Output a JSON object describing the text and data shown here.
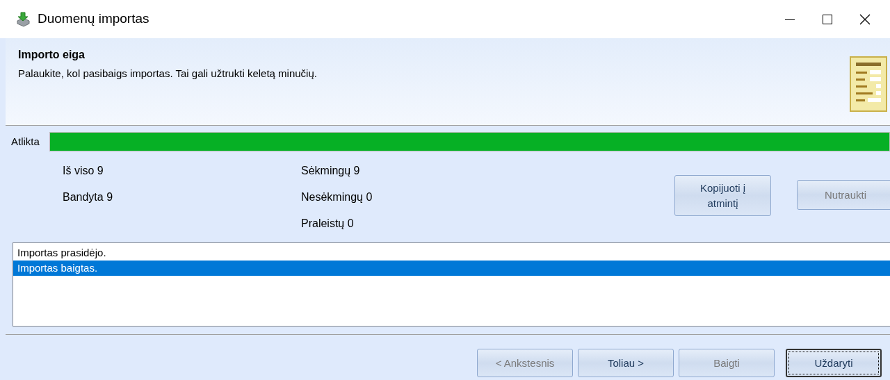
{
  "window": {
    "title": "Duomenų importas"
  },
  "header": {
    "title": "Importo eiga",
    "subtitle": "Palaukite, kol pasibaigs importas. Tai gali užtrukti keletą minučių."
  },
  "progress": {
    "label": "Atlikta",
    "level": 1
  },
  "stats_left": [
    "Iš viso 9",
    "Bandyta 9"
  ],
  "stats_right": [
    "Sėkmingų 9",
    "Nesėkmingų 0",
    "Praleistų 0"
  ],
  "side_buttons": [
    {
      "label": "Kopijuoti į atmintį",
      "disabled": false
    },
    {
      "label": "Nutraukti",
      "disabled": true
    }
  ],
  "log": [
    {
      "text": "Importas prasidėjo.",
      "selected": false
    },
    {
      "text": "Importas baigtas.",
      "selected": true
    }
  ],
  "buttons": [
    {
      "label": "< Ankstesnis",
      "disabled": true,
      "focused": false
    },
    {
      "label": "Toliau >",
      "disabled": false,
      "focused": false
    },
    {
      "label": "Baigti",
      "disabled": true,
      "focused": false
    },
    {
      "label": "Uždaryti",
      "disabled": false,
      "focused": true
    }
  ]
}
